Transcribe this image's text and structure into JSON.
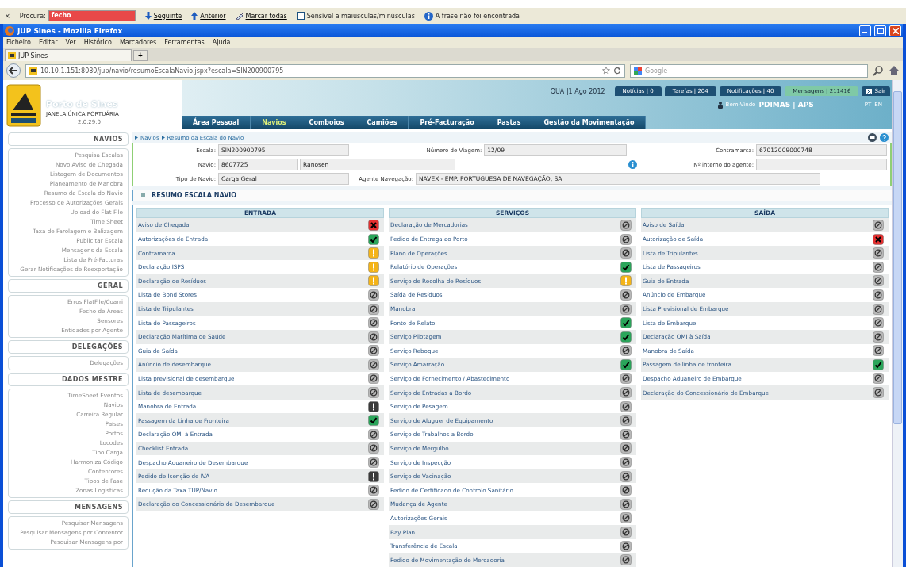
{
  "find_bar": {
    "close": "×",
    "label": "Procura:",
    "value": "fecho",
    "not_found": true,
    "next": "Seguinte",
    "previous": "Anterior",
    "highlight_all": "Marcar todas",
    "match_case": {
      "label": "Sensível a maiúsculas/minúsculas",
      "checked": false
    },
    "message": "A frase não foi encontrada"
  },
  "browser": {
    "title": "JUP Sines - Mozilla Firefox",
    "menu": [
      "Ficheiro",
      "Editar",
      "Ver",
      "Histórico",
      "Marcadores",
      "Ferramentas",
      "Ajuda"
    ],
    "tab": "JUP Sines",
    "new_tab": "+",
    "url": "10.10.1.151:8080/jup/navio/resumoEscalaNavio.jspx?escala=SIN200900795",
    "search_placeholder": "Google"
  },
  "header": {
    "brand": "Porto de Sines",
    "subtitle": "JANELA ÚNICA PORTUÁRIA",
    "version": "2.0.29.0",
    "date": "QUA |1 Ago 2012",
    "counters": [
      {
        "label": "Notícias | 0",
        "selected": false
      },
      {
        "label": "Tarefas | 204",
        "selected": false
      },
      {
        "label": "Notificações | 40",
        "selected": false
      },
      {
        "label": "Mensagens | 211416",
        "selected": true
      }
    ],
    "logout": "Sair",
    "welcome": "Bem-Vindo",
    "user": "PDIMAS | APS",
    "languages": [
      "PT",
      "EN"
    ],
    "nav": [
      {
        "label": "Área Pessoal",
        "selected": false
      },
      {
        "label": "Navios",
        "selected": true
      },
      {
        "label": "Comboios",
        "selected": false
      },
      {
        "label": "Camiões",
        "selected": false
      },
      {
        "label": "Pré-Facturação",
        "selected": false
      },
      {
        "label": "Pastas",
        "selected": false
      },
      {
        "label": "Gestão da Movimentação",
        "selected": false
      }
    ]
  },
  "sidebar": [
    {
      "title": "NAVIOS",
      "items": [
        "Pesquisa Escalas",
        "Novo Aviso de Chegada",
        "Listagem de Documentos",
        "Planeamento de Manobra",
        "Resumo da Escala do Navio",
        "Processo de Autorizações Gerais",
        "Upload do Flat File",
        "Time Sheet",
        "Taxa de Farolagem e Balizagem",
        "Publicitar Escala",
        "Mensagens da Escala",
        "Lista de Pré-Facturas",
        "Gerar Notificações de Reexportação"
      ]
    },
    {
      "title": "GERAL",
      "items": [
        "Erros FlatFile/Coarri",
        "Fecho de Áreas",
        "Sensores",
        "Entidades por Agente"
      ]
    },
    {
      "title": "DELEGAÇÕES",
      "items": [
        "Delegações"
      ]
    },
    {
      "title": "DADOS MESTRE",
      "items": [
        "TimeSheet Eventos",
        "Navios",
        "Carreira Regular",
        "Países",
        "Portos",
        "Locodes",
        "Tipo Carga",
        "Harmoniza Código",
        "Contentores",
        "Tipos de Fase",
        "Zonas Logísticas"
      ]
    },
    {
      "title": "MENSAGENS",
      "items": [
        "Pesquisar Mensagens",
        "Pesquisar Mensagens por Contentor",
        "Pesquisar Mensagens por"
      ]
    }
  ],
  "breadcrumb": [
    "Navios",
    "Resumo da Escala do Navio"
  ],
  "form": {
    "escala": {
      "label": "Escala:",
      "value": "SIN200900795"
    },
    "viagem": {
      "label": "Número de Viagem:",
      "value": "12/09"
    },
    "contramarca": {
      "label": "Contramarca:",
      "value": "67012009000748"
    },
    "navio": {
      "label": "Navio:",
      "value": "8607725",
      "name": "Ranosen"
    },
    "interno": {
      "label": "Nº interno do agente:"
    },
    "tipo": {
      "label": "Tipo de Navio:",
      "value": "Carga Geral"
    },
    "agente": {
      "label": "Agente Navegação:",
      "value": "NAVEX - EMP. PORTUGUESA DE NAVEGAÇÃO, SA"
    }
  },
  "section_title": "RESUMO ESCALA NAVIO",
  "columns": [
    {
      "title": "ENTRADA",
      "rows": [
        {
          "label": "Aviso de Chegada",
          "kind": "error"
        },
        {
          "label": "Autorizações de Entrada",
          "kind": "ok"
        },
        {
          "label": "Contramarca",
          "kind": "warning"
        },
        {
          "label": "Declaração ISPS",
          "kind": "warning"
        },
        {
          "label": "Declaração de Resíduos",
          "kind": "warning"
        },
        {
          "label": "Lista de Bond Stores",
          "kind": "blocked"
        },
        {
          "label": "Lista de Tripulantes",
          "kind": "blocked"
        },
        {
          "label": "Lista de Passageiros",
          "kind": "blocked"
        },
        {
          "label": "Declaração Marítima de Saúde",
          "kind": "blocked"
        },
        {
          "label": "Guia de Saída",
          "kind": "blocked"
        },
        {
          "label": "Anúncio de desembarque",
          "kind": "blocked"
        },
        {
          "label": "Lista previsional de desembarque",
          "kind": "blocked"
        },
        {
          "label": "Lista de desembarque",
          "kind": "blocked"
        },
        {
          "label": "Manobra de Entrada",
          "kind": "alert"
        },
        {
          "label": "Passagem da Linha de Fronteira",
          "kind": "ok"
        },
        {
          "label": "Declaração OMI à Entrada",
          "kind": "blocked"
        },
        {
          "label": "Checklist Entrada",
          "kind": "blocked"
        },
        {
          "label": "Despacho Aduaneiro de Desembarque",
          "kind": "blocked"
        },
        {
          "label": "Pedido de Isenção de IVA",
          "kind": "alert"
        },
        {
          "label": "Redução da Taxa TUP/Navio",
          "kind": "blocked"
        },
        {
          "label": "Declaração do Concessionário de Desembarque",
          "kind": "blocked"
        }
      ]
    },
    {
      "title": "SERVIÇOS",
      "rows": [
        {
          "label": "Declaração de Mercadorias",
          "kind": "blocked"
        },
        {
          "label": "Pedido de Entrega ao Porto",
          "kind": "blocked"
        },
        {
          "label": "Plano de Operações",
          "kind": "blocked"
        },
        {
          "label": "Relatório de Operações",
          "kind": "ok"
        },
        {
          "label": "Serviço de Recolha de Resíduos",
          "kind": "warning"
        },
        {
          "label": "Saída de Resíduos",
          "kind": "blocked"
        },
        {
          "label": "Manobra",
          "kind": "blocked"
        },
        {
          "label": "Ponto de Relato",
          "kind": "ok"
        },
        {
          "label": "Serviço Pilotagem",
          "kind": "ok"
        },
        {
          "label": "Serviço Reboque",
          "kind": "blocked"
        },
        {
          "label": "Serviço Amarração",
          "kind": "ok"
        },
        {
          "label": "Serviço de Fornecimento / Abastecimento",
          "kind": "blocked"
        },
        {
          "label": "Serviço de Entradas a Bordo",
          "kind": "blocked"
        },
        {
          "label": "Serviço de Pesagem",
          "kind": "blocked"
        },
        {
          "label": "Serviço de Aluguer de Equipamento",
          "kind": "blocked"
        },
        {
          "label": "Serviço de Trabalhos a Bordo",
          "kind": "blocked"
        },
        {
          "label": "Serviço de Mergulho",
          "kind": "blocked"
        },
        {
          "label": "Serviço de Inspecção",
          "kind": "blocked"
        },
        {
          "label": "Serviço de Vacinação",
          "kind": "blocked"
        },
        {
          "label": "Pedido de Certificado de Controlo Sanitário",
          "kind": "blocked"
        },
        {
          "label": "Mudança de Agente",
          "kind": "blocked"
        },
        {
          "label": "Autorizações Gerais",
          "kind": "blocked"
        },
        {
          "label": "Bay Plan",
          "kind": "blocked"
        },
        {
          "label": "Transferência de Escala",
          "kind": "blocked"
        },
        {
          "label": "Pedido de Movimentação de Mercadoria",
          "kind": "blocked"
        }
      ]
    },
    {
      "title": "SAÍDA",
      "rows": [
        {
          "label": "Aviso de Saída",
          "kind": "blocked"
        },
        {
          "label": "Autorização de Saída",
          "kind": "error"
        },
        {
          "label": "Lista de Tripulantes",
          "kind": "blocked"
        },
        {
          "label": "Lista de Passageiros",
          "kind": "blocked"
        },
        {
          "label": "Guia de Entrada",
          "kind": "blocked"
        },
        {
          "label": "Anúncio de Embarque",
          "kind": "blocked"
        },
        {
          "label": "Lista Previsional de Embarque",
          "kind": "blocked"
        },
        {
          "label": "Lista de Embarque",
          "kind": "blocked"
        },
        {
          "label": "Declaração OMI à Saída",
          "kind": "blocked"
        },
        {
          "label": "Manobra de Saída",
          "kind": "blocked"
        },
        {
          "label": "Passagem de linha de fronteira",
          "kind": "ok"
        },
        {
          "label": "Despacho Aduaneiro de Embarque",
          "kind": "blocked"
        },
        {
          "label": "Declaração do Concessionário de Embarque",
          "kind": "blocked"
        }
      ]
    }
  ]
}
